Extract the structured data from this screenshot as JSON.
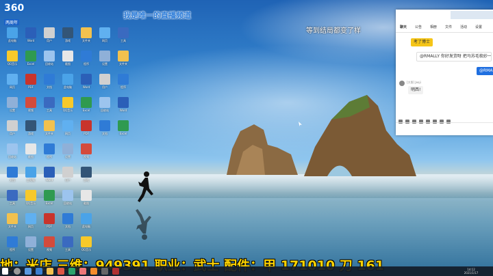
{
  "brand": {
    "title": "360",
    "subtitle": "两周年"
  },
  "overlays": {
    "top_left": "我是唯一的直播频道",
    "top_right": "等到结局都变了样"
  },
  "desktop_icons": [
    {
      "label": "此电脑",
      "color": "#4aa3e8"
    },
    {
      "label": "QQ音乐",
      "color": "#f7c92a"
    },
    {
      "label": "网页",
      "color": "#60b0f0"
    },
    {
      "label": "设置",
      "color": "#8fb0d8"
    },
    {
      "label": "用户",
      "color": "#d0d0d0"
    },
    {
      "label": "回收站",
      "color": "#9cc4ee"
    },
    {
      "label": "文档",
      "color": "#2f7bd6"
    },
    {
      "label": "工具",
      "color": "#3a6ac0"
    },
    {
      "label": "文件夹",
      "color": "#f2c14e"
    },
    {
      "label": "程序",
      "color": "#2f7bd6"
    },
    {
      "label": "Word",
      "color": "#2b5fb8"
    },
    {
      "label": "Excel",
      "color": "#2f9a50"
    },
    {
      "label": "PDF",
      "color": "#c8342c"
    },
    {
      "label": "视频",
      "color": "#d44b3c"
    },
    {
      "label": "游戏",
      "color": "#335577"
    },
    {
      "label": "截图",
      "color": "#e7e7e7"
    }
  ],
  "chat": {
    "tabs": [
      "聊天",
      "公告",
      "相册",
      "文件",
      "活动",
      "设置"
    ],
    "messages": [
      "考了博士",
      "@RMALLY 你好发货呀 把马苏毛梳妙一",
      "@RMA",
      "明西!"
    ],
    "sender": "[大哥] Jeoji"
  },
  "ticker": "地：米店    三维：949391    职业：武士    配件：甲 171010   刀 161",
  "tray": {
    "time": "14:12",
    "date": "2021/1/17"
  }
}
